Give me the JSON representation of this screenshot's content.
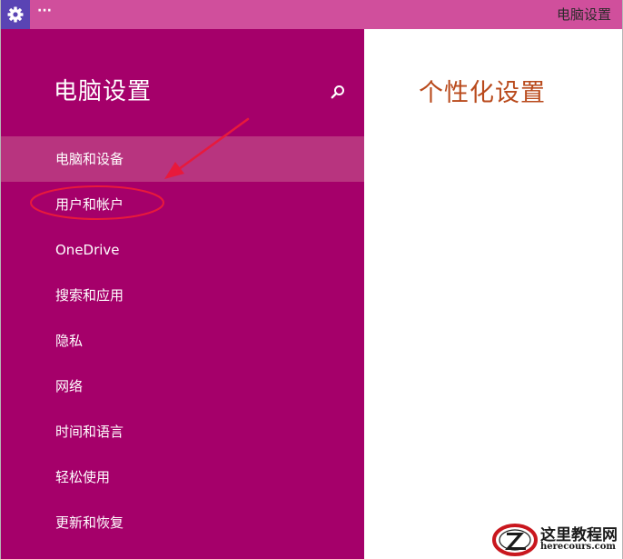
{
  "titlebar": {
    "menu_glyph": "···",
    "title": "电脑设置",
    "icon": "gear-icon",
    "icon_bg": "#5a44b4",
    "bar_color": "#d04f9c"
  },
  "sidebar": {
    "title": "电脑设置",
    "search_icon": "search-icon",
    "background": "#a5006a",
    "items": [
      {
        "label": "电脑和设备",
        "selected": true
      },
      {
        "label": "用户和帐户",
        "selected": false
      },
      {
        "label": "OneDrive",
        "selected": false
      },
      {
        "label": "搜索和应用",
        "selected": false
      },
      {
        "label": "隐私",
        "selected": false
      },
      {
        "label": "网络",
        "selected": false
      },
      {
        "label": "时间和语言",
        "selected": false
      },
      {
        "label": "轻松使用",
        "selected": false
      },
      {
        "label": "更新和恢复",
        "selected": false
      }
    ]
  },
  "content": {
    "title": "个性化设置",
    "title_color": "#b94a1c"
  },
  "annotation": {
    "color": "#e8193c",
    "target": "用户和帐户"
  },
  "watermark": {
    "name": "这里教程网",
    "url": "herecours.com"
  }
}
